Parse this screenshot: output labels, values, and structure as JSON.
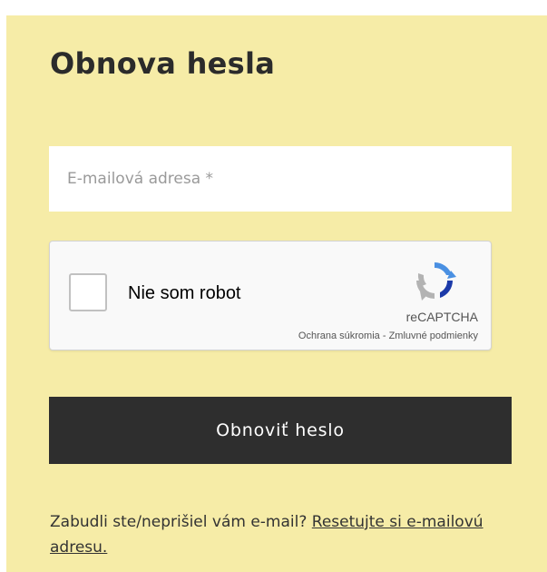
{
  "page": {
    "title": "Obnova hesla"
  },
  "form": {
    "email_placeholder": "E-mailová adresa *",
    "submit_label": "Obnoviť heslo"
  },
  "captcha": {
    "label": "Nie som robot",
    "brand": "reCAPTCHA",
    "privacy_link": "Ochrana súkromia",
    "separator": " - ",
    "terms_link": "Zmluvné podmienky",
    "checked": false
  },
  "footer": {
    "text": "Zabudli ste/neprišiel vám e-mail? ",
    "link": "Resetujte si e-mailovú adresu."
  },
  "colors": {
    "panel_background": "#f6eca7",
    "button_background": "#2e2e2e",
    "recaptcha_blue": "#1c3aa9",
    "recaptcha_lightblue": "#4a90e2",
    "recaptcha_gray": "#b3b3b3"
  },
  "icons": {
    "recaptcha": "recaptcha-logo-icon"
  }
}
